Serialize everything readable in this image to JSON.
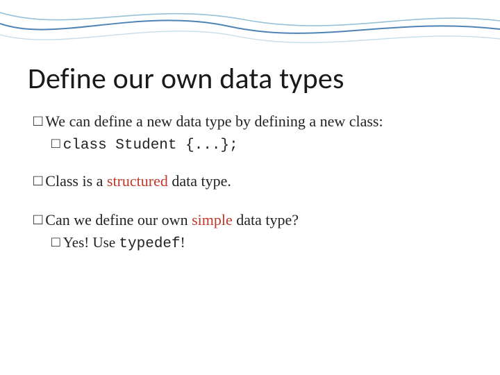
{
  "title": "Define our own data types",
  "bullets": {
    "b1": {
      "pre": "We can define a new data type by defining a new class:",
      "sq": "□"
    },
    "b1a": {
      "code": "class Student {...};",
      "sq": "□"
    },
    "b2": {
      "t1": "Class is a ",
      "red": "structured",
      "t2": " data type.",
      "sq": "□"
    },
    "b3": {
      "t1": "Can we define our own ",
      "red": "simple",
      "t2": " data type?",
      "sq": "□"
    },
    "b3a": {
      "t1": "Yes! Use ",
      "code": "typedef",
      "t2": "!",
      "sq": "□"
    }
  }
}
